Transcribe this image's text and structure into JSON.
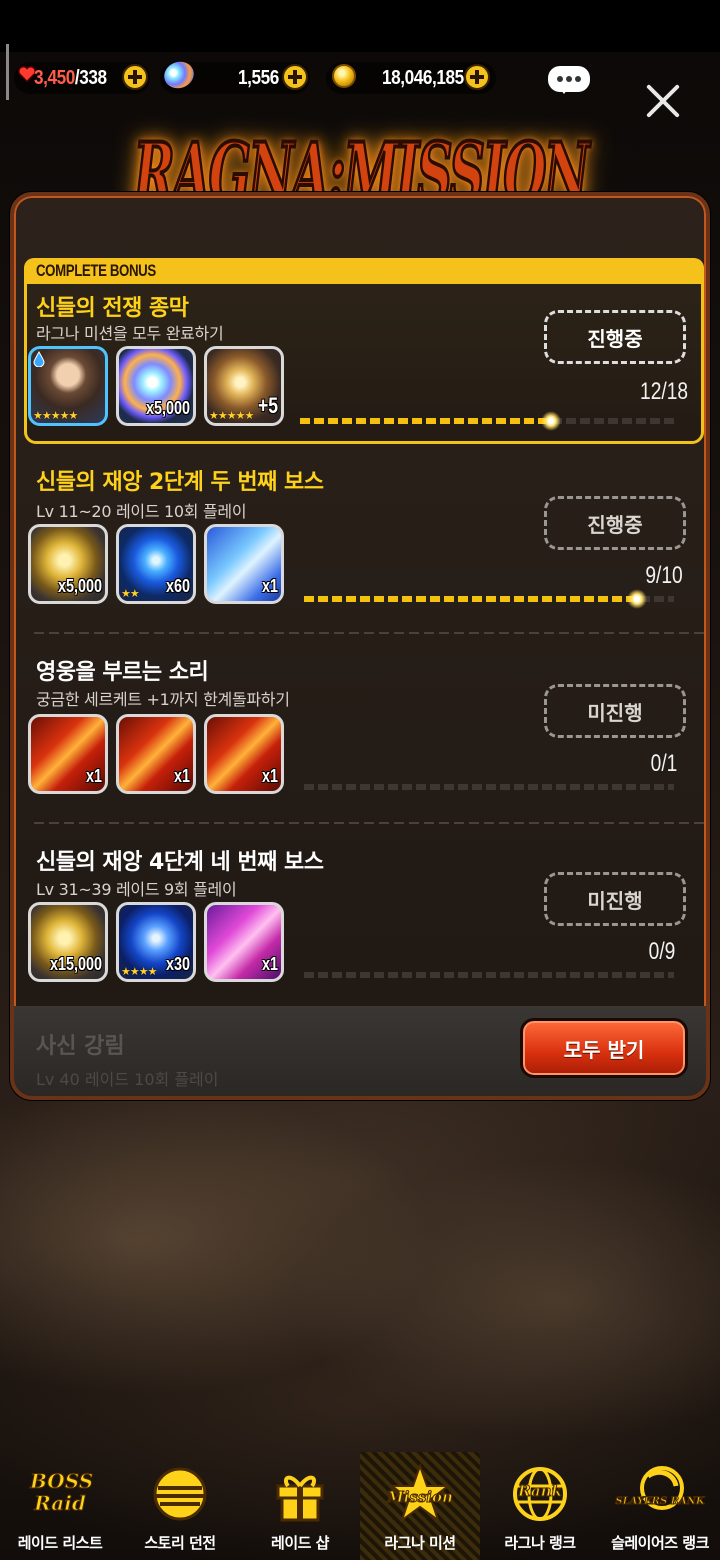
{
  "resources": {
    "stamina_current": "3,450",
    "stamina_max": "/338",
    "gems": "1,556",
    "gold": "18,046,185"
  },
  "header": {
    "logo_text": "RAGNA:MISSION"
  },
  "bonus": {
    "label": "COMPLETE BONUS",
    "title": "신들의 전쟁 종막",
    "subtitle": "라그나 미션을 모두 완료하기",
    "status": "진행중",
    "progress": "12/18",
    "progress_fraction": 0.667,
    "rewards": [
      {
        "icon": "hero-portrait-icon",
        "qty": "",
        "stars": "★★★★★"
      },
      {
        "icon": "rainbow-gem-icon",
        "qty": "x5,000",
        "stars": ""
      },
      {
        "icon": "gold-equipment-icon",
        "qty": "+5",
        "stars": "★★★★★"
      }
    ]
  },
  "missions": [
    {
      "title": "신들의 재앙 2단계 두 번째 보스",
      "subtitle": "Lv 11~20 레이드 10회 플레이",
      "status": "진행중",
      "progress": "9/10",
      "progress_fraction": 0.9,
      "rewards": [
        {
          "icon": "gold-medal-icon",
          "qty": "x5,000",
          "stars": ""
        },
        {
          "icon": "blue-crystal-icon",
          "qty": "x60",
          "stars": "★★"
        },
        {
          "icon": "blue-ticket-icon",
          "qty": "x1",
          "stars": ""
        }
      ]
    },
    {
      "title": "영웅을 부르는 소리",
      "subtitle": "궁금한 세르케트 +1까지 한계돌파하기",
      "status": "미진행",
      "progress": "0/1",
      "progress_fraction": 0,
      "rewards": [
        {
          "icon": "red-5star-ticket-icon",
          "qty": "x1",
          "stars": ""
        },
        {
          "icon": "red-5star-ticket-icon",
          "qty": "x1",
          "stars": ""
        },
        {
          "icon": "red-5star-ticket-icon",
          "qty": "x1",
          "stars": ""
        }
      ]
    },
    {
      "title": "신들의 재앙 4단계 네 번째 보스",
      "subtitle": "Lv 31~39 레이드 9회 플레이",
      "status": "미진행",
      "progress": "0/9",
      "progress_fraction": 0,
      "rewards": [
        {
          "icon": "gold-medal-icon",
          "qty": "x15,000",
          "stars": ""
        },
        {
          "icon": "blue-diamond-icon",
          "qty": "x30",
          "stars": "★★★★"
        },
        {
          "icon": "pink-ticket-icon",
          "qty": "x1",
          "stars": ""
        }
      ]
    }
  ],
  "faded_mission": {
    "title": "사신 강림",
    "subtitle": "Lv 40 레이드 10회 플레이"
  },
  "claim_all_label": "모두 받기",
  "nav": [
    {
      "label": "레이드 리스트",
      "icon": "boss-raid-icon",
      "logo": "BOSS Raid"
    },
    {
      "label": "스토리 던전",
      "icon": "story-dungeon-icon",
      "logo": ""
    },
    {
      "label": "레이드 샵",
      "icon": "gift-box-icon",
      "logo": ""
    },
    {
      "label": "라그나 미션",
      "icon": "mission-star-icon",
      "logo": "Mission",
      "active": true
    },
    {
      "label": "라그나 랭크",
      "icon": "rank-globe-icon",
      "logo": "Rank"
    },
    {
      "label": "슬레이어즈 랭크",
      "icon": "slayers-rank-icon",
      "logo": "SLAYERS RANK"
    }
  ],
  "colors": {
    "accent": "#f4c21a",
    "panel_border": "#c2571e",
    "claim_button": "#d8300e"
  }
}
